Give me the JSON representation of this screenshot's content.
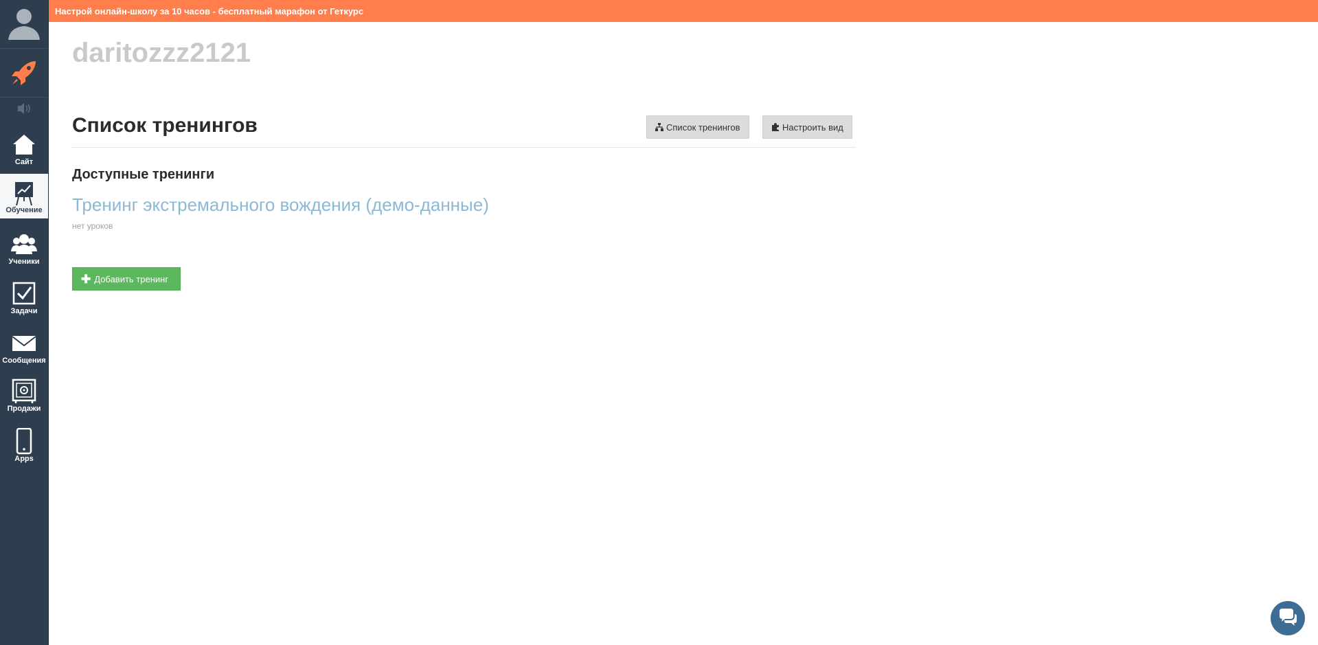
{
  "banner": {
    "text": "Настрой онлайн-школу за 10 часов - бесплатный марафон от Геткурс"
  },
  "sidebar": {
    "avatar_icon": "user-avatar-icon",
    "rocket_icon": "rocket-icon",
    "speaker_icon": "speaker-icon",
    "items": [
      {
        "label": "Сайт",
        "icon": "home-icon",
        "active": false
      },
      {
        "label": "Обучение",
        "icon": "presentation-chart-icon",
        "active": true
      },
      {
        "label": "Ученики",
        "icon": "users-icon",
        "active": false
      },
      {
        "label": "Задачи",
        "icon": "checkbox-icon",
        "active": false
      },
      {
        "label": "Сообщения",
        "icon": "envelope-icon",
        "active": false
      },
      {
        "label": "Продажи",
        "icon": "safe-icon",
        "active": false
      },
      {
        "label": "Apps",
        "icon": "mobile-icon",
        "active": false
      }
    ]
  },
  "header": {
    "username": "daritozzz2121",
    "page_title": "Список тренингов",
    "buttons": {
      "list_label": "Список тренингов",
      "view_label": "Настроить вид"
    }
  },
  "main": {
    "section_title": "Доступные тренинги",
    "trainings": [
      {
        "title": "Тренинг экстремального вождения (демо-данные)",
        "meta": "нет уроков"
      }
    ],
    "add_button_label": "Добавить тренинг"
  },
  "colors": {
    "banner": "#ff7e4b",
    "sidebar": "#2e3e4e",
    "link": "#8bb9d5",
    "add_button": "#5cb85c",
    "chat_button": "#3d6d94"
  }
}
